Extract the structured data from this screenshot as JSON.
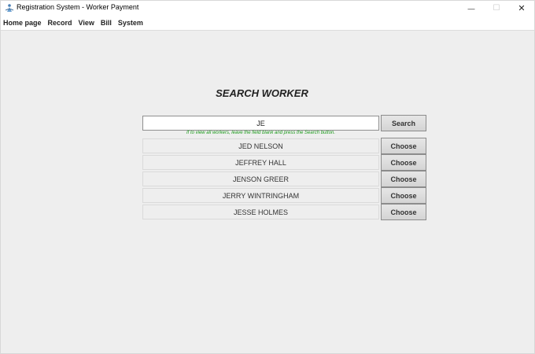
{
  "window": {
    "title": "Registration System - Worker Payment",
    "minimize_glyph": "—",
    "maximize_glyph": "☐",
    "close_glyph": "✕"
  },
  "menu": [
    "Home page",
    "Record",
    "View",
    "Bill",
    "System"
  ],
  "search": {
    "heading": "SEARCH WORKER",
    "value": "JE",
    "button_label": "Search",
    "hint": "If to view all workers, leave the field blank and press the Search button."
  },
  "results": [
    {
      "name": "JED NELSON",
      "action": "Choose"
    },
    {
      "name": "JEFFREY HALL",
      "action": "Choose"
    },
    {
      "name": "JENSON GREER",
      "action": "Choose"
    },
    {
      "name": "JERRY WINTRINGHAM",
      "action": "Choose"
    },
    {
      "name": "JESSE HOLMES",
      "action": "Choose"
    }
  ],
  "colors": {
    "background": "#eeeeee",
    "hint_text": "#1b9a1b",
    "app_icon": "#4a7fb5"
  },
  "icons": {
    "app": "java-app-icon"
  }
}
